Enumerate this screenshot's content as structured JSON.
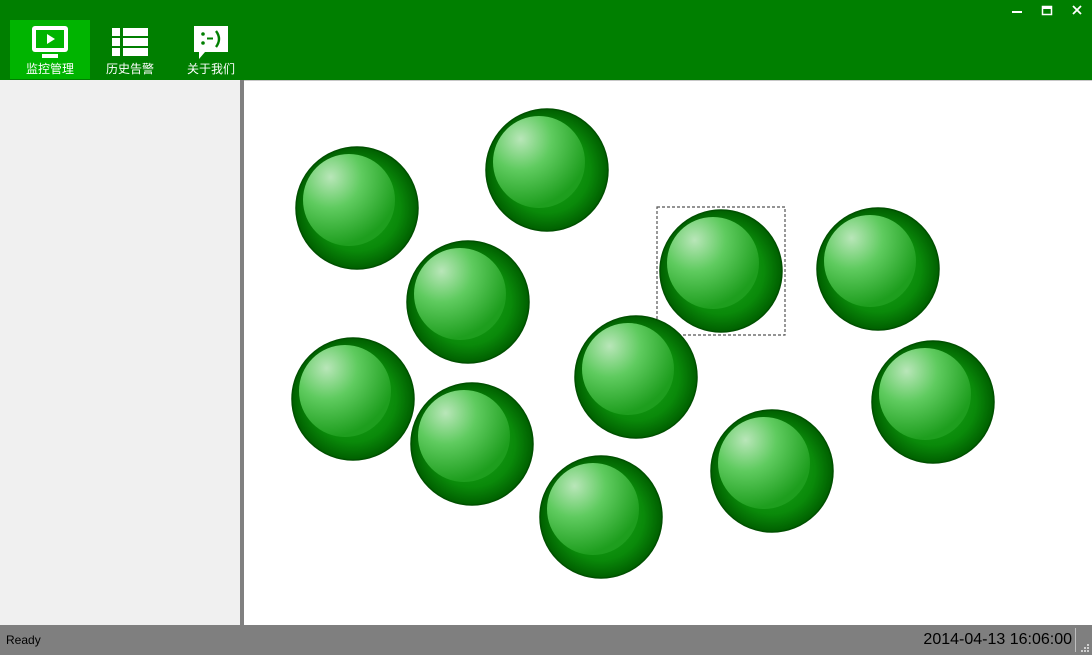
{
  "toolbar": {
    "buttons": [
      {
        "label": "监控管理",
        "icon": "monitor-icon",
        "active": true
      },
      {
        "label": "历史告警",
        "icon": "list-icon",
        "active": false
      },
      {
        "label": "关于我们",
        "icon": "smiley-chat-icon",
        "active": false
      }
    ]
  },
  "window_controls": [
    "minimize-icon",
    "maximize-icon",
    "close-icon"
  ],
  "monitor": {
    "node_count": 11,
    "node_status_color": "#008000",
    "selected_node_index": 5
  },
  "statusbar": {
    "status": "Ready",
    "datetime": "2014-04-13 16:06:00"
  },
  "colors": {
    "toolbar_bg": "#007f00",
    "active_button_bg": "#00b400",
    "sidebar_bg": "#f0f0f0",
    "statusbar_bg": "#7f7f7f"
  }
}
